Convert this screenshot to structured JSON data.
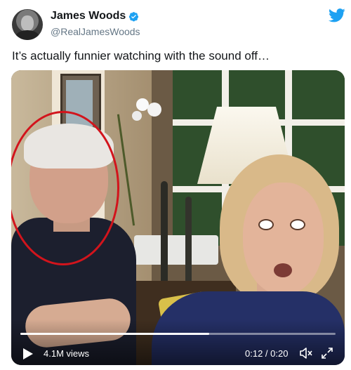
{
  "tweet": {
    "author_name": "James Woods",
    "handle": "@RealJamesWoods",
    "text": "It’s actually funnier watching with the sound off…",
    "verified": true
  },
  "video": {
    "views": "4.1M views",
    "time": "0:12 / 0:20",
    "progress_fraction": 0.6
  },
  "colors": {
    "verified_blue": "#1da1f2",
    "twitter_blue": "#1da1f2",
    "annotation_red": "#d2141c"
  },
  "icons": {
    "play": "play-icon",
    "mute": "muted-speaker-icon",
    "fullscreen": "fullscreen-icon",
    "brand": "twitter-bird-icon"
  }
}
